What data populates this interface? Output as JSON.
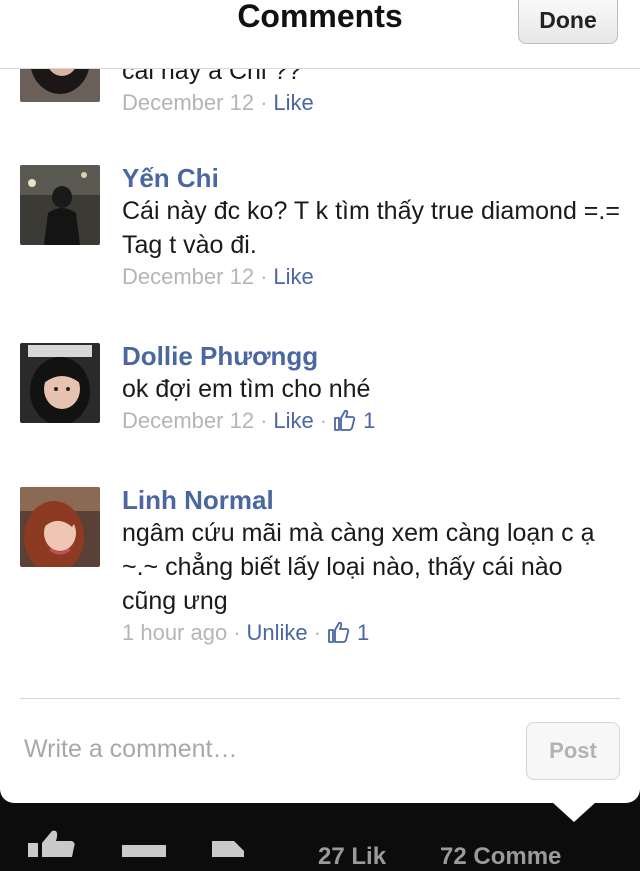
{
  "header": {
    "title": "Comments",
    "done_label": "Done"
  },
  "comments": [
    {
      "author": "",
      "text": "cái này à Chi ??",
      "time": "December 12",
      "like_label": "Like",
      "like_count": ""
    },
    {
      "author": "Yến Chi",
      "text": "Cái này đc ko? T k tìm thấy true diamond =.= Tag t vào đi.",
      "time": "December 12",
      "like_label": "Like",
      "like_count": ""
    },
    {
      "author": "Dollie Phươngg",
      "text": "ok đợi em tìm cho nhé",
      "time": "December 12",
      "like_label": "Like",
      "like_count": "1"
    },
    {
      "author": "Linh Normal",
      "text": "ngâm cứu mãi mà càng xem càng loạn c ạ ~.~ chẳng biết lấy loại nào, thấy cái nào cũng ưng",
      "time": "1 hour ago",
      "like_label": "Unlike",
      "like_count": "1"
    }
  ],
  "composer": {
    "placeholder": "Write a comment…",
    "post_label": "Post"
  },
  "footer": {
    "likes_text": "27 Lik",
    "comments_text": "72 Comme"
  },
  "icons": [
    "thumbs-up-icon",
    "comment-icon",
    "share-icon"
  ],
  "colors": {
    "accent": "#4b67a1",
    "muted": "#b5b5b5"
  }
}
